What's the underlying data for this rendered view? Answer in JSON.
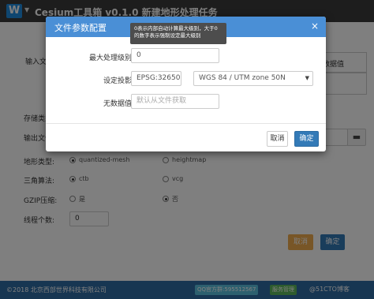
{
  "app": {
    "logo": "W",
    "title": "Cesium工具箱 v0.1.0 新建地形处理任务"
  },
  "form": {
    "input_label": "输入文件",
    "table_header": "无数据值",
    "storage_label": "存储类型",
    "output_label": "输出文件",
    "terrain_type_label": "地形类型:",
    "terrain_options": [
      "quantized-mesh",
      "heightmap"
    ],
    "terrain_selected": "quantized-mesh",
    "triangulation_label": "三角算法:",
    "triangulation_options": [
      "ctb",
      "vcg"
    ],
    "triangulation_selected": "ctb",
    "gzip_label": "GZIP压缩:",
    "gzip_options": [
      "是",
      "否"
    ],
    "gzip_selected": "否",
    "threads_label": "线程个数:",
    "threads_value": "0",
    "cancel_label": "取消",
    "ok_label": "确定"
  },
  "footer": {
    "copyright": "©2018 北京西部世界科技有限公司",
    "qq_badge": "QQ官方群:595512567",
    "service_badge": "服务管理",
    "watermark": "@51CTO博客"
  },
  "modal": {
    "title": "文件参数配置",
    "tooltip": "0表示内部自动计算最大级别，大于0的数字表示强制设定最大级别",
    "max_level_label": "最大处理级别:",
    "max_level_value": "0",
    "projection_label": "设定投影:",
    "projection_code": "EPSG:32650",
    "projection_name": "WGS 84 / UTM zone 50N",
    "nodata_label": "无数据值:",
    "nodata_placeholder": "默认从文件获取",
    "cancel_label": "取消",
    "ok_label": "确定"
  },
  "colors": {
    "header_dark": "#3a3a3a",
    "modal_header": "#4a8fd6",
    "primary": "#337ab7",
    "warning": "#f0ad4e",
    "footer": "#2e6da4"
  }
}
